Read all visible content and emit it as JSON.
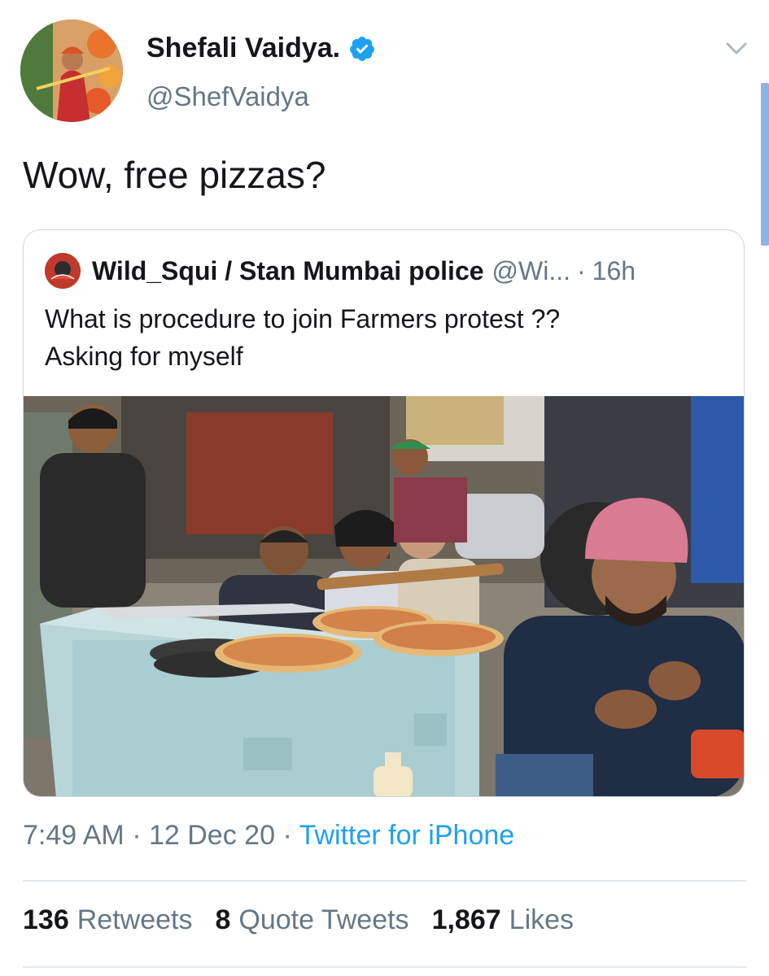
{
  "tweet": {
    "author": {
      "display_name": "Shefali Vaidya.",
      "handle": "@ShefVaidya"
    },
    "text": "Wow, free pizzas?",
    "quoted": {
      "display_name": "Wild_Squi / Stan Mumbai police",
      "handle": "@Wi...",
      "separator": "·",
      "time": "16h",
      "text_lines": [
        "What is procedure to join Farmers protest ??",
        "Asking for myself"
      ]
    },
    "meta": {
      "time": "7:49 AM",
      "date": "12 Dec 20",
      "sep1": "·",
      "sep2": "·",
      "source": "Twitter for iPhone"
    },
    "stats": {
      "retweets_count": "136",
      "retweets_label": "Retweets",
      "quotes_count": "8",
      "quotes_label": "Quote Tweets",
      "likes_count": "1,867",
      "likes_label": "Likes"
    }
  },
  "colors": {
    "link": "#1da1f2",
    "secondary_text": "#657786",
    "border": "#ccd6dd"
  },
  "icons": [
    "verified-badge-icon",
    "chevron-down-icon"
  ]
}
